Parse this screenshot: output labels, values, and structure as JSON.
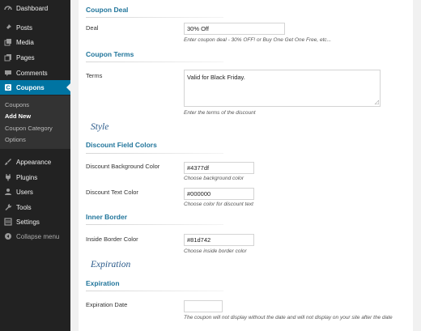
{
  "sidebar": {
    "items": [
      {
        "label": "Dashboard",
        "icon": "dashboard-icon"
      },
      {
        "label": "Posts",
        "icon": "pin-icon"
      },
      {
        "label": "Media",
        "icon": "media-icon"
      },
      {
        "label": "Pages",
        "icon": "pages-icon"
      },
      {
        "label": "Comments",
        "icon": "comments-icon"
      },
      {
        "label": "Coupons",
        "icon": "coupon-icon"
      }
    ],
    "submenu": [
      "Coupons",
      "Add New",
      "Coupon Category",
      "Options"
    ],
    "items_bottom": [
      {
        "label": "Appearance",
        "icon": "brush-icon"
      },
      {
        "label": "Plugins",
        "icon": "plugin-icon"
      },
      {
        "label": "Users",
        "icon": "users-icon"
      },
      {
        "label": "Tools",
        "icon": "wrench-icon"
      },
      {
        "label": "Settings",
        "icon": "settings-icon"
      }
    ],
    "collapse": "Collapse menu",
    "colors": {
      "bg": "#222222",
      "active": "#0074a2",
      "submenu_bg": "#333333"
    }
  },
  "form": {
    "coupon_deal": {
      "heading": "Coupon Deal",
      "label": "Deal",
      "value": "30% Off",
      "help": "Enter coupon deal - 30% OFF! or Buy One Get One Free, etc..."
    },
    "coupon_terms": {
      "heading": "Coupon Terms",
      "label": "Terms",
      "value": "Valid for Black Friday.",
      "help": "Enter the terms of the discount"
    },
    "style_title": "Style",
    "discount_colors": {
      "heading": "Discount Field Colors",
      "bg_label": "Discount Background Color",
      "bg_value": "#4377df",
      "bg_help": "Choose background color",
      "text_label": "Discount Text Color",
      "text_value": "#000000",
      "text_help": "Choose color for discount text"
    },
    "inner_border": {
      "heading": "Inner Border",
      "label": "Inside Border Color",
      "value": "#81d742",
      "help": "Choose inside border color"
    },
    "expiration_title": "Expiration",
    "expiration": {
      "heading": "Expiration",
      "label": "Expiration Date",
      "value": "",
      "help": "The coupon will not display without the date and will not display on your site after the date"
    }
  }
}
